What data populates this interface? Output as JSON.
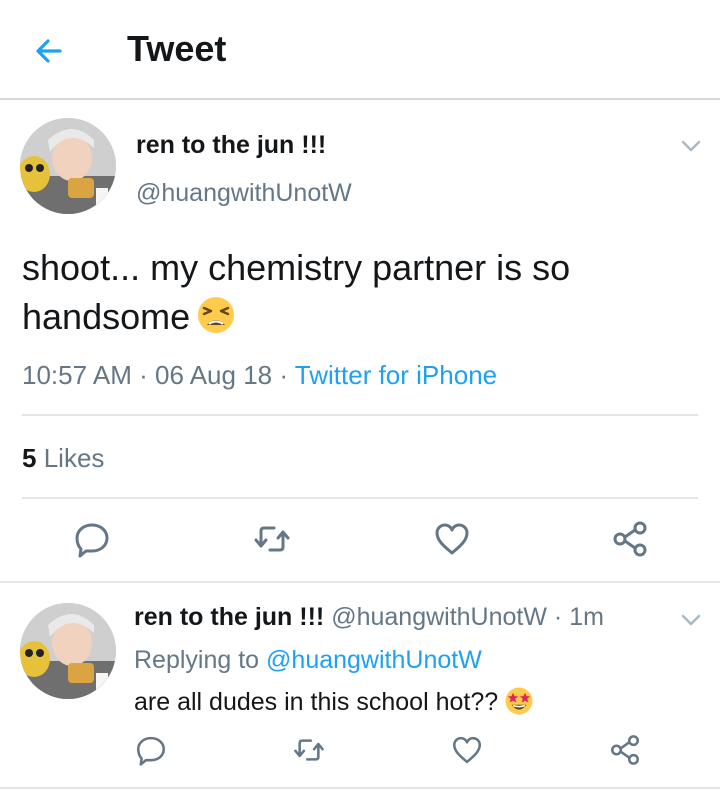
{
  "header": {
    "title": "Tweet"
  },
  "tweet": {
    "display_name": "ren to the jun !!!",
    "handle": "@huangwithUnotW",
    "text": "shoot... my chemistry partner is so handsome",
    "emoji": "tired-face-emoji",
    "time": "10:57 AM",
    "date": "06 Aug 18",
    "separator": "·",
    "source": "Twitter for iPhone",
    "likes_count": "5",
    "likes_label": "Likes"
  },
  "reply": {
    "display_name": "ren to the jun !!!",
    "handle": "@huangwithUnotW",
    "separator": "·",
    "age": "1m",
    "replying_prefix": "Replying to",
    "replying_handle": "@huangwithUnotW",
    "text": "are all dudes in this school hot??",
    "emoji": "star-struck-emoji"
  },
  "colors": {
    "accent": "#1da1f2",
    "secondary_text": "#657786",
    "primary_text": "#14171a",
    "divider": "#e1e6ea"
  },
  "icons": {
    "back": "arrow-left-icon",
    "more": "chevron-down-icon",
    "reply": "comment-bubble-icon",
    "retweet": "retweet-icon",
    "like": "heart-icon",
    "share": "share-icon"
  }
}
